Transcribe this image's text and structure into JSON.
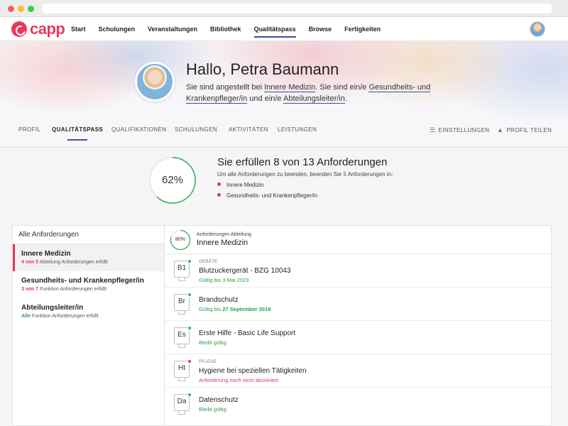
{
  "app": {
    "name": "capp"
  },
  "nav": [
    {
      "label": "Start",
      "active": false
    },
    {
      "label": "Schulungen",
      "active": false
    },
    {
      "label": "Veranstaltungen",
      "active": false
    },
    {
      "label": "Bibliothek",
      "active": false
    },
    {
      "label": "Qualitätspass",
      "active": true
    },
    {
      "label": "Browse",
      "active": false
    },
    {
      "label": "Fertigkeiten",
      "active": false
    }
  ],
  "hero": {
    "greeting": "Hallo, Petra Baumann",
    "intro": "Sie sind angestellt bei ",
    "dept": "Innere Medizin",
    "mid": ". Sie sind ein/e ",
    "role1": "Gesundheits- und Krankenpfleger/in",
    "and": " und ein/e ",
    "role2": "Abteilungsleiter/in",
    "end": "."
  },
  "profile_tabs": [
    {
      "label": "PROFIL",
      "active": false
    },
    {
      "label": "QUALITÄTSPASS",
      "active": true
    },
    {
      "label": "QUALIFIKATIONEN",
      "active": false
    },
    {
      "label": "SCHULUNGEN",
      "active": false
    },
    {
      "label": "AKTIVITÄTEN",
      "active": false
    },
    {
      "label": "LEISTUNGEN",
      "active": false
    }
  ],
  "tab_actions": {
    "settings": "EINSTELLUNGEN",
    "share": "PROFIL TEILEN"
  },
  "summary": {
    "percent_label": "62%",
    "progress": 0.62,
    "title": "Sie erfüllen 8 von 13 Anforderungen",
    "subtitle": "Um alle Anforderungen zu beenden, beenden Sie 5 Anforderungen in:",
    "items": [
      "Innere Medizin",
      "Gesundheits- und Krankenpfleger/in"
    ]
  },
  "left_panel": {
    "header": "Alle Anforderungen",
    "items": [
      {
        "title": "Innere Medizin",
        "count": "4 von 5",
        "rest": " Abteilung Anforderungen erfüllt",
        "count_color": "r",
        "active": true
      },
      {
        "title": "Gesundheits- und Krankenpfleger/in",
        "count": "3 von 7",
        "rest": " Funktion Anforderungen erfüllt",
        "count_color": "r",
        "active": false
      },
      {
        "title": "Abteilungsleiter/in",
        "count": "Alle",
        "rest": " Funktion Anforderungen erfüllt",
        "count_color": "g",
        "active": false
      }
    ]
  },
  "right_panel": {
    "percent_label": "80%",
    "progress": 0.8,
    "subtitle": "Anforderungen Abteilung",
    "title": "Innere Medizin",
    "rows": [
      {
        "badge": "B1",
        "category": "GERÄTE",
        "title": "Blutzuckergerät - BZG 10043",
        "status_prefix": "Gültig bis ",
        "status_value": "3 Mai 2023",
        "ok": true
      },
      {
        "badge": "Br",
        "category": "",
        "title": "Brandschutz",
        "status_prefix": "Gültig bis ",
        "status_value": "27 September 2019",
        "ok": true
      },
      {
        "badge": "Es",
        "category": "",
        "title": "Erste Hilfe - Basic Life Support",
        "status_prefix": "Bleibt gültig",
        "status_value": "",
        "ok": true
      },
      {
        "badge": "Ht",
        "category": "PFLEGE",
        "title": "Hygiene bei speziellen Tätigkeiten",
        "status_prefix": "Anforderung noch nicht absolviert",
        "status_value": "",
        "ok": false
      },
      {
        "badge": "Da",
        "category": "",
        "title": "Datenschutz",
        "status_prefix": "Bleibt gültig",
        "status_value": "",
        "ok": true
      }
    ]
  },
  "colors": {
    "brand": "#e83a5d",
    "accent": "#3d4ea0",
    "ok": "#2e9b4a",
    "warn": "#e0355a"
  },
  "icons": {
    "settings": "sliders-icon",
    "share": "share-icon"
  }
}
